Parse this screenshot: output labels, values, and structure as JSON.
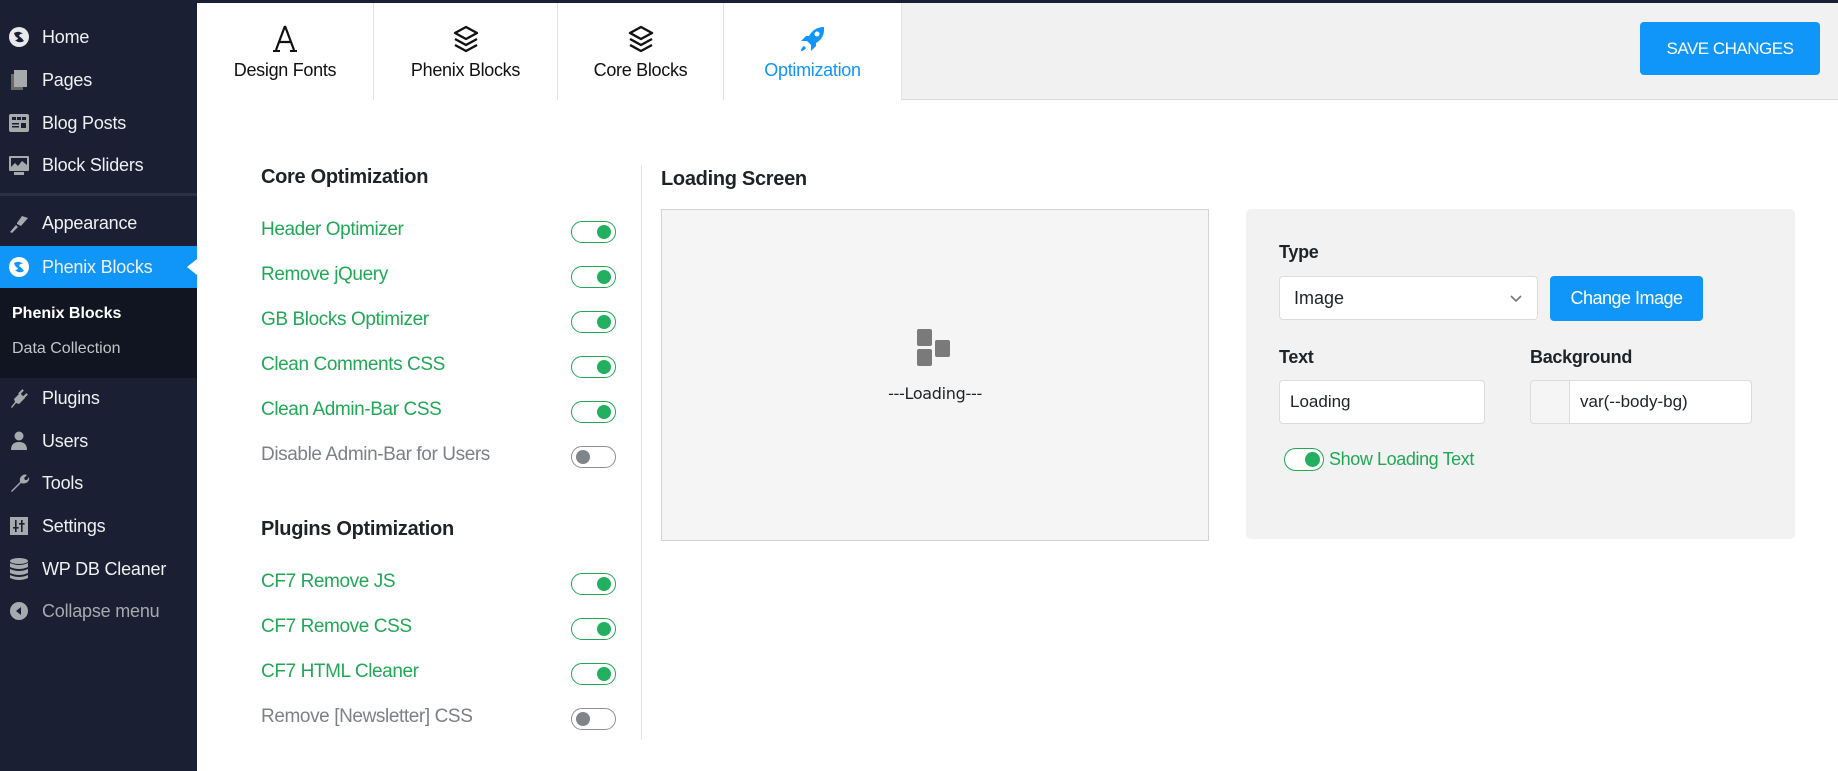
{
  "sidebar": {
    "items": [
      {
        "label": "Home",
        "icon": "phoenix-logo-icon"
      },
      {
        "label": "Pages",
        "icon": "pages-icon"
      },
      {
        "label": "Blog Posts",
        "icon": "blog-posts-icon"
      },
      {
        "label": "Block Sliders",
        "icon": "slider-icon"
      },
      {
        "label": "Appearance",
        "icon": "paintbrush-icon"
      },
      {
        "label": "Phenix Blocks",
        "icon": "phoenix-logo-icon",
        "active": true
      },
      {
        "label": "Plugins",
        "icon": "plug-icon"
      },
      {
        "label": "Users",
        "icon": "user-icon"
      },
      {
        "label": "Tools",
        "icon": "wrench-icon"
      },
      {
        "label": "Settings",
        "icon": "settings-sliders-icon"
      },
      {
        "label": "WP DB Cleaner",
        "icon": "database-icon"
      },
      {
        "label": "Collapse menu",
        "icon": "collapse-arrow-icon"
      }
    ],
    "submenu": [
      {
        "label": "Phenix Blocks",
        "current": true
      },
      {
        "label": "Data Collection",
        "current": false
      }
    ]
  },
  "tabs": [
    {
      "label": "Design Fonts",
      "icon": "font-letter-icon",
      "active": false
    },
    {
      "label": "Phenix Blocks",
      "icon": "layers-icon",
      "active": false
    },
    {
      "label": "Core Blocks",
      "icon": "layers-icon",
      "active": false
    },
    {
      "label": "Optimization",
      "icon": "rocket-icon",
      "active": true
    }
  ],
  "header": {
    "save_label": "SAVE CHANGES"
  },
  "core_optimization": {
    "title": "Core Optimization",
    "options": [
      {
        "label": "Header Optimizer",
        "enabled": true
      },
      {
        "label": "Remove jQuery",
        "enabled": true
      },
      {
        "label": "GB Blocks Optimizer",
        "enabled": true
      },
      {
        "label": "Clean Comments CSS",
        "enabled": true
      },
      {
        "label": "Clean Admin-Bar CSS",
        "enabled": true
      },
      {
        "label": "Disable Admin-Bar for Users",
        "enabled": false
      }
    ]
  },
  "plugins_optimization": {
    "title": "Plugins Optimization",
    "options": [
      {
        "label": "CF7 Remove JS",
        "enabled": true
      },
      {
        "label": "CF7 Remove CSS",
        "enabled": true
      },
      {
        "label": "CF7 HTML Cleaner",
        "enabled": true
      },
      {
        "label": "Remove [Newsletter] CSS",
        "enabled": false
      }
    ]
  },
  "loading_screen": {
    "title": "Loading Screen",
    "preview_text": "---Loading---",
    "type_label": "Type",
    "type_value": "Image",
    "change_image_label": "Change Image",
    "text_label": "Text",
    "text_value": "Loading",
    "background_label": "Background",
    "background_value": "var(--body-bg)",
    "show_text_label": "Show Loading Text",
    "show_text_enabled": true
  },
  "colors": {
    "accent": "#1095f8",
    "sidebar_bg": "#1a1f33",
    "enabled_green": "#22a757",
    "disabled_gray": "#7c8087"
  }
}
